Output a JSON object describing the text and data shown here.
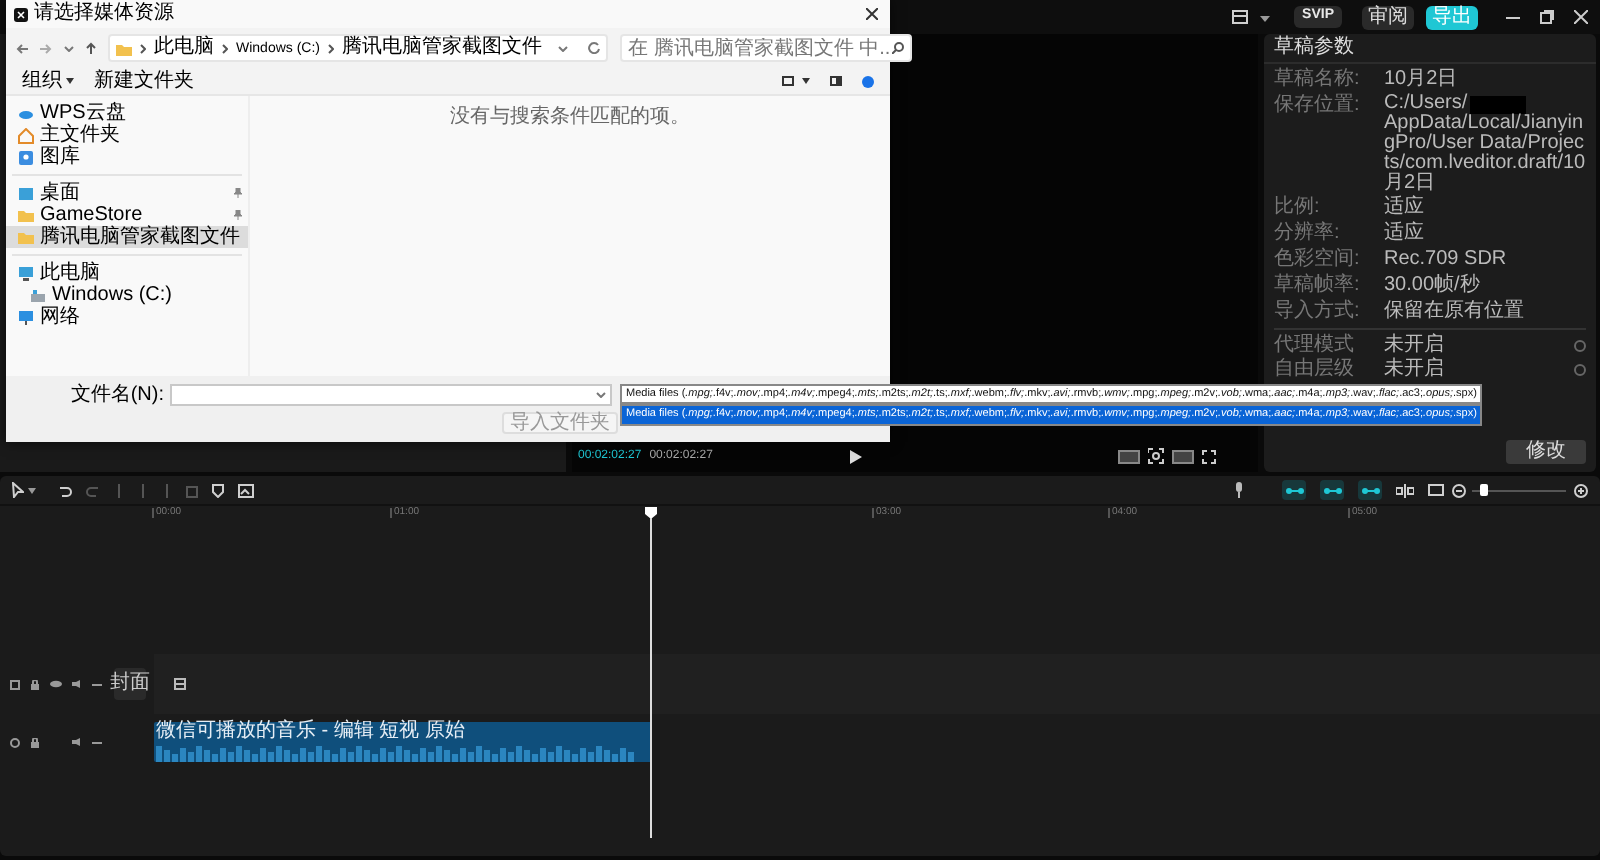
{
  "app_bar": {
    "vip_badge": "SVIP",
    "review_button": "审阅",
    "export_button": "导出"
  },
  "dialog": {
    "title": "请选择媒体资源",
    "breadcrumb": [
      "此电脑",
      "Windows (C:)",
      "腾讯电脑管家截图文件"
    ],
    "search": {
      "placeholder": "在 腾讯电脑管家截图文件 中..."
    },
    "toolbar": {
      "organize": "组织",
      "new_folder": "新建文件夹"
    },
    "sidebar_groups": [
      {
        "items": [
          {
            "label": "WPS云盘",
            "kind": "cloud",
            "pinned": false,
            "selected": false
          },
          {
            "label": "主文件夹",
            "kind": "home",
            "pinned": false,
            "selected": false
          },
          {
            "label": "图库",
            "kind": "gallery",
            "pinned": false,
            "selected": false
          }
        ]
      },
      {
        "items": [
          {
            "label": "桌面",
            "kind": "desktop",
            "pinned": true,
            "selected": false
          },
          {
            "label": "GameStore",
            "kind": "folder",
            "pinned": true,
            "selected": false
          },
          {
            "label": "腾讯电脑管家截图文件",
            "kind": "folder",
            "pinned": false,
            "selected": true
          }
        ]
      },
      {
        "items": [
          {
            "label": "此电脑",
            "kind": "pc",
            "pinned": false,
            "selected": false
          },
          {
            "label": "Windows (C:)",
            "kind": "drive",
            "pinned": false,
            "selected": false
          },
          {
            "label": "网络",
            "kind": "network",
            "pinned": false,
            "selected": false
          }
        ]
      }
    ],
    "empty_message": "没有与搜索条件匹配的项。",
    "file_name_label": "文件名(N):",
    "import_folder_button": {
      "label": "导入文件夹",
      "disabled": true
    }
  },
  "file_type_dropdown": {
    "value": "Media files (*.mpg;*.f4v;*.mov;*.mp4;*.m4v;*.mpeg4;*.mts;*.m2ts;*.m2t;*.ts;*.mxf;*.webm;*.flv;*.mkv;*.avi;*.rmvb;*.wmv;*.mpg;*.mpeg;*.m2v;*.vob;*.wma;*.aac;*.m4a;*.mp3;*.wav;*.flac;*.ac3;*.opus;*.spx)",
    "options": [
      {
        "label": "Media files (*.mpg;*.f4v;*.mov;*.mp4;*.m4v;*.mpeg4;*.mts;*.m2ts;*.m2t;*.ts;*.mxf;*.webm;*.flv;*.mkv;*.avi;*.rmvb;*.wmv;*.mpg;*.mpeg;*.m2v;*.vob;*.wma;*.aac;*.m4a;*.mp3;*.wav;*.flac;*.ac3;*.opus;*.spx)",
        "selected": true
      }
    ]
  },
  "preview": {
    "current_time": "00:02:02:27",
    "duration": "00:02:02:27"
  },
  "draft_panel": {
    "title": "草稿参数",
    "rows": [
      {
        "kind": "text",
        "label": "草稿名称:",
        "value": "10月2日"
      },
      {
        "kind": "redacted_path",
        "label": "保存位置:",
        "value_start": "C:/Users/",
        "value_end": "AppData/Local/JianyingPro/User Data/Projects/com.lveditor.draft/10月2日"
      },
      {
        "kind": "text",
        "label": "比例:",
        "value": "适应"
      },
      {
        "kind": "text",
        "label": "分辨率:",
        "value": "适应"
      },
      {
        "kind": "text",
        "label": "色彩空间:",
        "value": "Rec.709 SDR"
      },
      {
        "kind": "text",
        "label": "草稿帧率:",
        "value": "30.00帧/秒"
      },
      {
        "kind": "text",
        "label": "导入方式:",
        "value": "保留在原有位置"
      }
    ],
    "settings": [
      {
        "label": "代理模式",
        "value": "未开启"
      },
      {
        "label": "自由层级",
        "value": "未开启"
      }
    ],
    "edit_button": "修改"
  },
  "timeline": {
    "toggles": [
      {
        "on": true
      },
      {
        "on": true
      },
      {
        "on": true
      }
    ],
    "zoom": {
      "level": 0.1
    },
    "ruler": [
      "00:00",
      "01:00",
      "03:00",
      "04:00",
      "05:00"
    ],
    "cover_button": "封面",
    "clip": {
      "title": "微信可播放的音乐 - 编辑 短视 原始"
    }
  }
}
